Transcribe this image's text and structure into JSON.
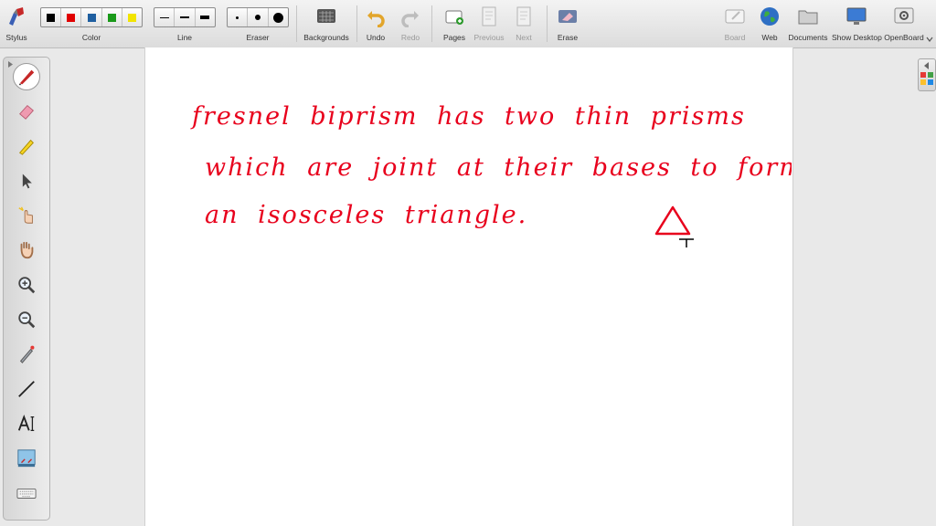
{
  "toolbar": {
    "stylus": "Stylus",
    "color": "Color",
    "line": "Line",
    "eraser": "Eraser",
    "backgrounds": "Backgrounds",
    "undo": "Undo",
    "redo": "Redo",
    "pages": "Pages",
    "previous": "Previous",
    "next": "Next",
    "erase": "Erase",
    "board": "Board",
    "web": "Web",
    "documents": "Documents",
    "show_desktop": "Show Desktop",
    "openboard": "OpenBoard"
  },
  "colors": {
    "palette": [
      "#000000",
      "#e00000",
      "#1f5fa0",
      "#1a9a1a",
      "#f2e400"
    ],
    "ink": "#e8001c"
  },
  "left_tools": [
    "pen-icon",
    "eraser-icon",
    "highlighter-icon",
    "selector-icon",
    "play-icon",
    "hand-icon",
    "zoom-in-icon",
    "zoom-out-icon",
    "laser-pointer-icon",
    "line-icon",
    "text-icon",
    "capture-icon",
    "keyboard-icon"
  ],
  "handwriting": {
    "line1": "fresnel biprism has two thin prisms",
    "line2": "which are joint at their bases to form",
    "line3": "an isosceles triangle."
  }
}
